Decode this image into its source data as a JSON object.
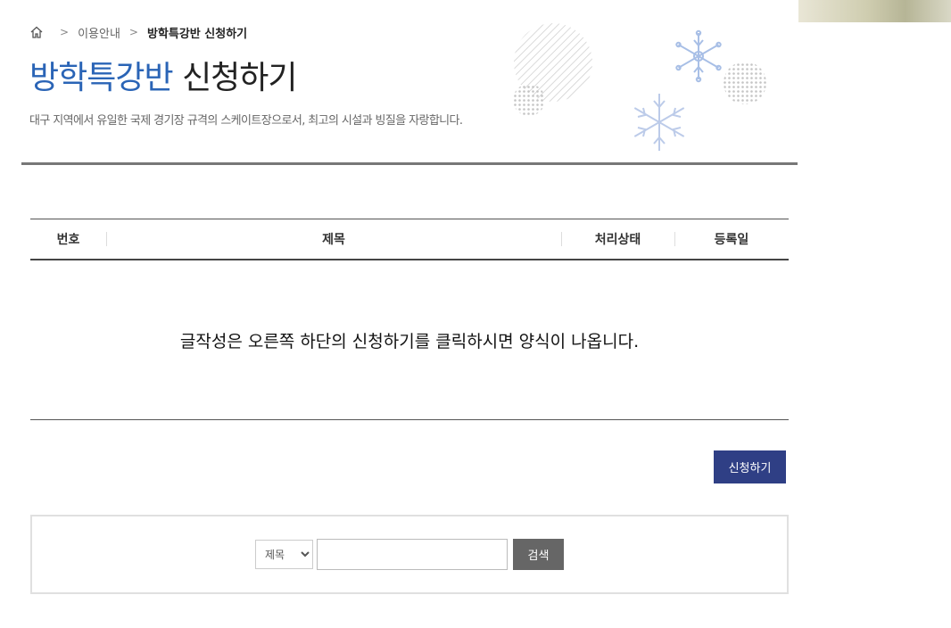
{
  "breadcrumb": {
    "home_icon": "home-icon",
    "separator": ">",
    "parent": "이용안내",
    "current": "방학특강반 신청하기"
  },
  "page": {
    "title_accent": "방학특강반",
    "title_rest": "신청하기",
    "subtitle": "대구 지역에서 유일한 국제 경기장 규격의 스케이트장으로서, 최고의 시설과 빙질을 자랑합니다.",
    "accent_color": "#2a64b6",
    "decoration_icons": [
      "snowflake-icon",
      "dotted-circle-icon",
      "striped-circle-icon"
    ]
  },
  "board": {
    "columns": [
      "번호",
      "제목",
      "처리상태",
      "등록일"
    ],
    "empty_message": "글작성은 오른쪽 하단의 신청하기를 클릭하시면 양식이 나옵니다."
  },
  "actions": {
    "apply_label": "신청하기",
    "apply_color": "#2f3f85"
  },
  "search": {
    "field_selected": "제목",
    "query_value": "",
    "submit_label": "검색"
  }
}
